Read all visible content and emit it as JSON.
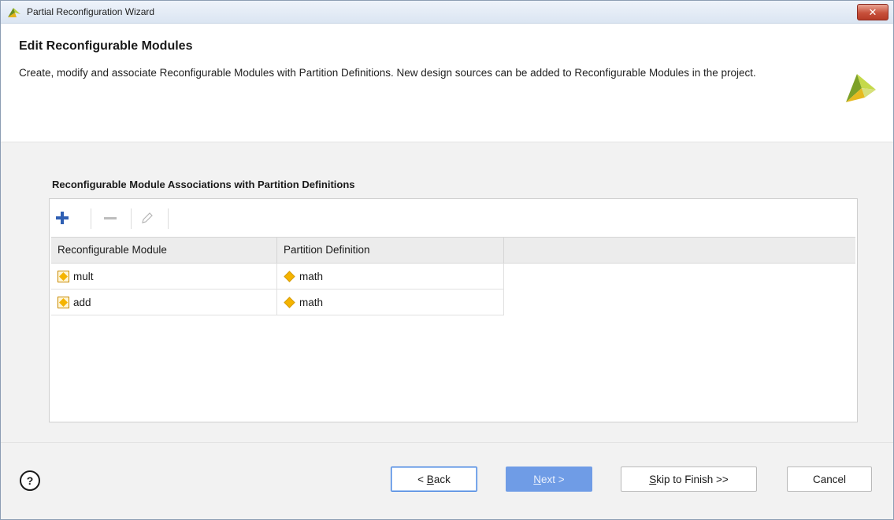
{
  "window": {
    "title": "Partial Reconfiguration Wizard",
    "close_label": "✕"
  },
  "header": {
    "heading": "Edit Reconfigurable Modules",
    "description": "Create, modify and associate Reconfigurable Modules with Partition Definitions. New design sources can be added to Reconfigurable Modules in the project."
  },
  "section": {
    "label": "Reconfigurable Module Associations with Partition Definitions"
  },
  "toolbar": {
    "add_icon": "plus-icon",
    "remove_icon": "minus-icon",
    "edit_icon": "pencil-icon"
  },
  "table": {
    "columns": [
      "Reconfigurable Module",
      "Partition Definition"
    ],
    "rows": [
      {
        "module": "mult",
        "partition": "math"
      },
      {
        "module": "add",
        "partition": "math"
      }
    ]
  },
  "footer": {
    "help_label": "?",
    "back_prefix": "< ",
    "back_mnemonic": "B",
    "back_rest": "ack",
    "next_mnemonic": "N",
    "next_rest": "ext >",
    "skip_mnemonic": "S",
    "skip_rest": "kip to Finish >>",
    "cancel_label": "Cancel"
  },
  "colors": {
    "accent_blue": "#2f5fb3",
    "module_icon": "#f5b400",
    "partition_icon": "#f5b400",
    "next_button_bg": "#6f9ce6"
  }
}
